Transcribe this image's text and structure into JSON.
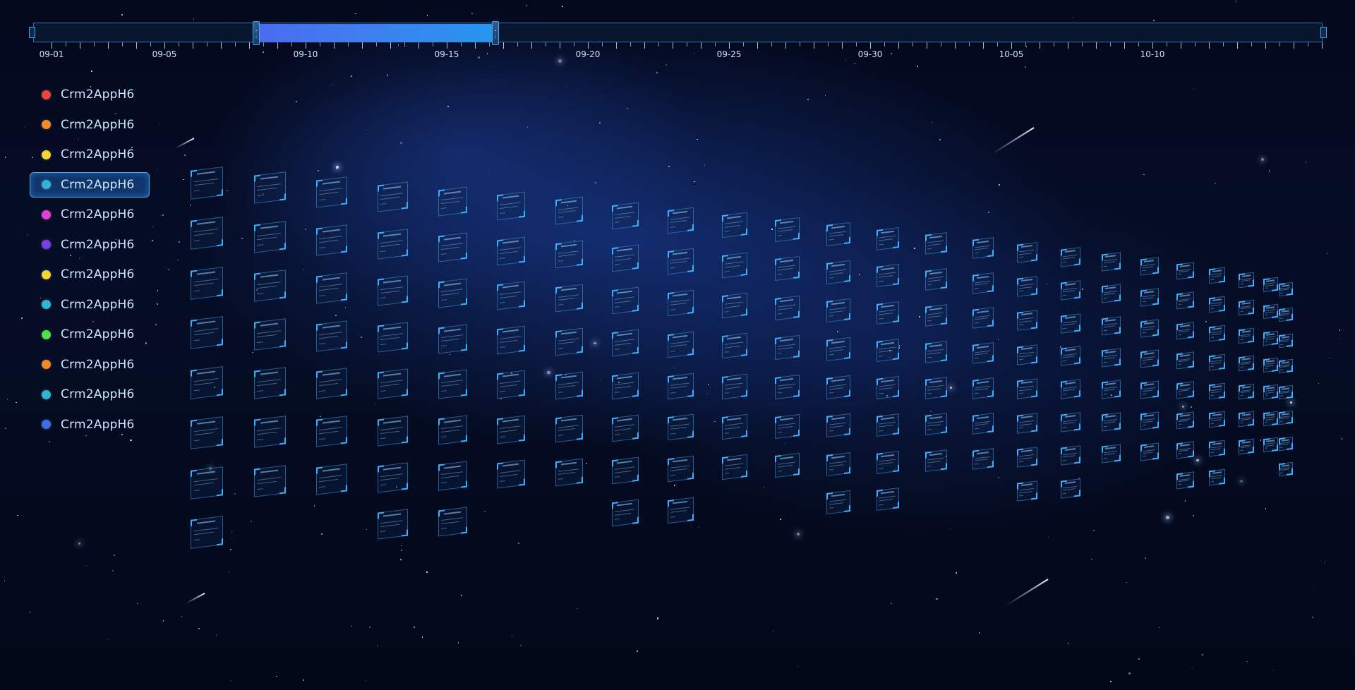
{
  "timeline": {
    "labels": [
      "09-01",
      "09-05",
      "09-10",
      "09-15",
      "09-20",
      "09-25",
      "09-30",
      "10-05",
      "10-10"
    ],
    "selected_range": {
      "start": "09-08",
      "end": "09-17"
    }
  },
  "legend": {
    "items": [
      {
        "label": "Crm2AppH6",
        "color": "#f0433e"
      },
      {
        "label": "Crm2AppH6",
        "color": "#f28a2c"
      },
      {
        "label": "Crm2AppH6",
        "color": "#f3d335"
      },
      {
        "label": "Crm2AppH6",
        "color": "#2fb6d6",
        "active": true
      },
      {
        "label": "Crm2AppH6",
        "color": "#e63ed8"
      },
      {
        "label": "Crm2AppH6",
        "color": "#7a3ee8"
      },
      {
        "label": "Crm2AppH6",
        "color": "#f3d335"
      },
      {
        "label": "Crm2AppH6",
        "color": "#2fb6d6"
      },
      {
        "label": "Crm2AppH6",
        "color": "#4fe04a"
      },
      {
        "label": "Crm2AppH6",
        "color": "#f28a2c"
      },
      {
        "label": "Crm2AppH6",
        "color": "#2fb6d6"
      },
      {
        "label": "Crm2AppH6",
        "color": "#3f6fe6"
      }
    ]
  },
  "colors": {
    "accent": "#2596ee",
    "range_start": "#4a6cf0",
    "border": "#2f74a8"
  }
}
